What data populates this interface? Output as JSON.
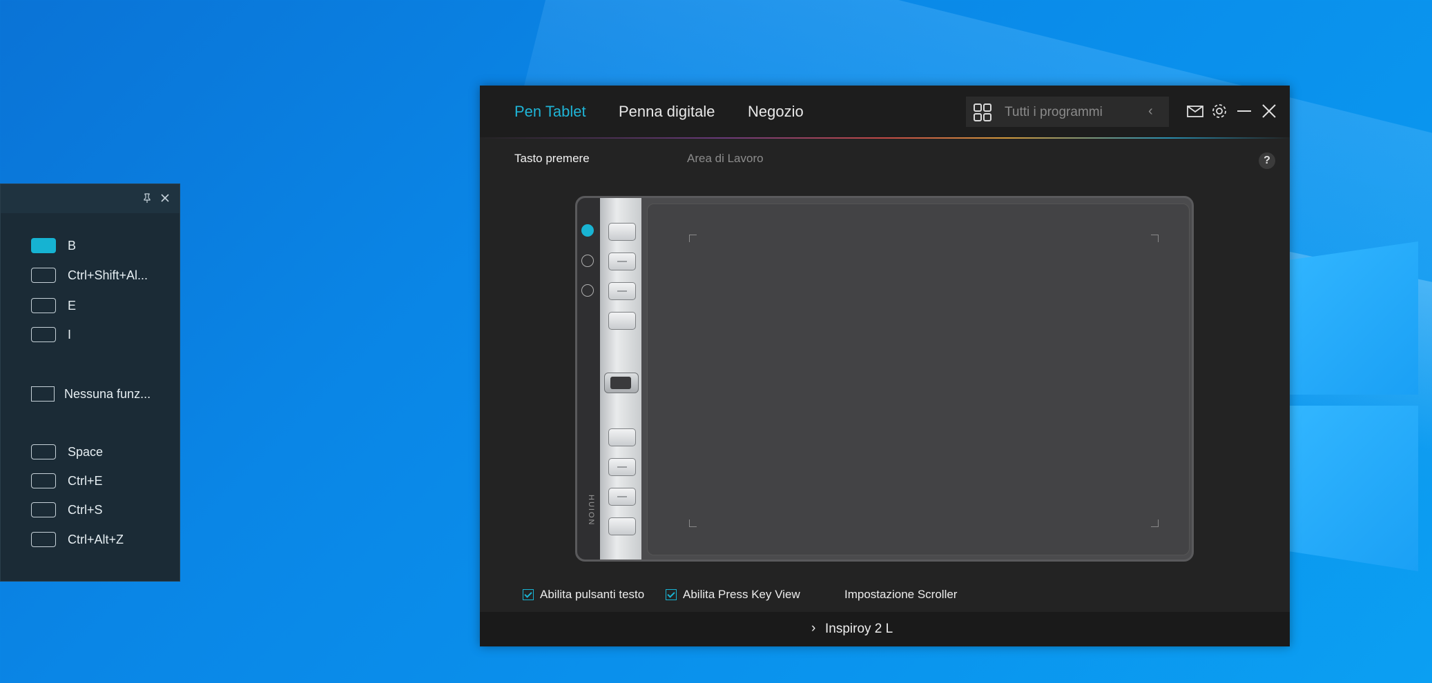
{
  "key_panel": {
    "items": [
      {
        "label": "B",
        "active": true
      },
      {
        "label": "Ctrl+Shift+Al...",
        "active": false
      },
      {
        "label": "E",
        "active": false
      },
      {
        "label": "I",
        "active": false
      },
      {
        "label": "Nessuna funz...",
        "active": false
      },
      {
        "label": "Space",
        "active": false
      },
      {
        "label": "Ctrl+E",
        "active": false
      },
      {
        "label": "Ctrl+S",
        "active": false
      },
      {
        "label": "Ctrl+Alt+Z",
        "active": false
      }
    ]
  },
  "app": {
    "nav_tabs": [
      "Pen Tablet",
      "Penna digitale",
      "Negozio"
    ],
    "program_select": {
      "value": "Tutti i programmi"
    },
    "subtabs": [
      "Tasto premere",
      "Area di Lavoro"
    ],
    "help_label": "?",
    "brand_text": "HUION",
    "options": {
      "enable_text_buttons": "Abilita pulsanti testo",
      "enable_press_key_view": "Abilita Press Key View",
      "scroller_settings": "Impostazione Scroller"
    },
    "device_name": "Inspiroy 2 L"
  },
  "colors": {
    "accent": "#1fb4d6"
  }
}
